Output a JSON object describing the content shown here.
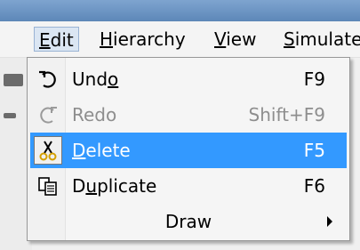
{
  "menubar": {
    "items": [
      {
        "label": "Edit",
        "mnemonic_index": 0,
        "open": true
      },
      {
        "label": "Hierarchy",
        "mnemonic_index": 0
      },
      {
        "label": "View",
        "mnemonic_index": 0
      },
      {
        "label": "Simulate",
        "mnemonic_index": 0
      }
    ]
  },
  "edit_menu": {
    "items": [
      {
        "label": "Undo",
        "shortcut": "F9",
        "icon": "undo-icon",
        "enabled": true,
        "highlighted": false,
        "mnemonic_index": 3
      },
      {
        "label": "Redo",
        "shortcut": "Shift+F9",
        "icon": "redo-icon",
        "enabled": false,
        "highlighted": false
      },
      {
        "label": "Delete",
        "shortcut": "F5",
        "icon": "scissors-icon",
        "enabled": true,
        "highlighted": true,
        "mnemonic_index": 0
      },
      {
        "label": "Duplicate",
        "shortcut": "F6",
        "icon": "duplicate-icon",
        "enabled": true,
        "highlighted": false,
        "mnemonic_index": 1
      },
      {
        "label": "Draw",
        "shortcut": "",
        "icon": "",
        "enabled": true,
        "highlighted": false,
        "submenu": true
      }
    ]
  },
  "colors": {
    "highlight": "#3399ff",
    "disabled_text": "#8e8e8e",
    "menu_background": "#f5f5f5",
    "titlebar": "#6e96c4"
  }
}
